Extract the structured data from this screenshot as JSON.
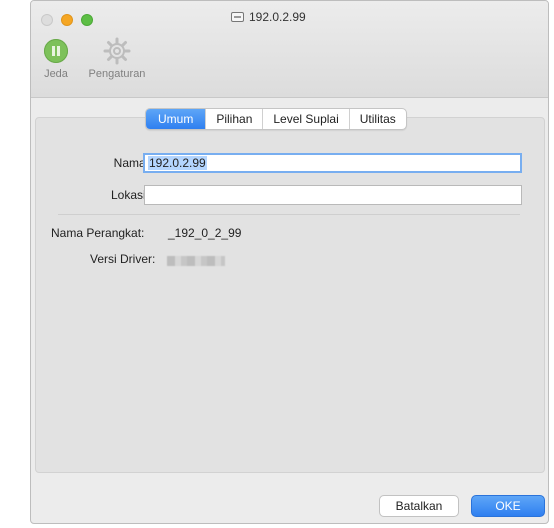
{
  "window": {
    "title": "192.0.2.99"
  },
  "toolbar": {
    "pause_label": "Jeda",
    "settings_label": "Pengaturan"
  },
  "tabs": [
    {
      "label": "Umum",
      "active": true
    },
    {
      "label": "Pilihan",
      "active": false
    },
    {
      "label": "Level Suplai",
      "active": false
    },
    {
      "label": "Utilitas",
      "active": false
    }
  ],
  "form": {
    "name_label": "Nama:",
    "name_value": "192.0.2.99",
    "location_label": "Lokasi:",
    "location_value": ""
  },
  "info": {
    "device_name_label": "Nama Perangkat:",
    "device_name_value": "_192_0_2_99",
    "driver_version_label": "Versi Driver:"
  },
  "buttons": {
    "cancel": "Batalkan",
    "ok": "OKE"
  },
  "colors": {
    "accent": "#2f7ff0",
    "pause_green": "#7dc15a"
  }
}
